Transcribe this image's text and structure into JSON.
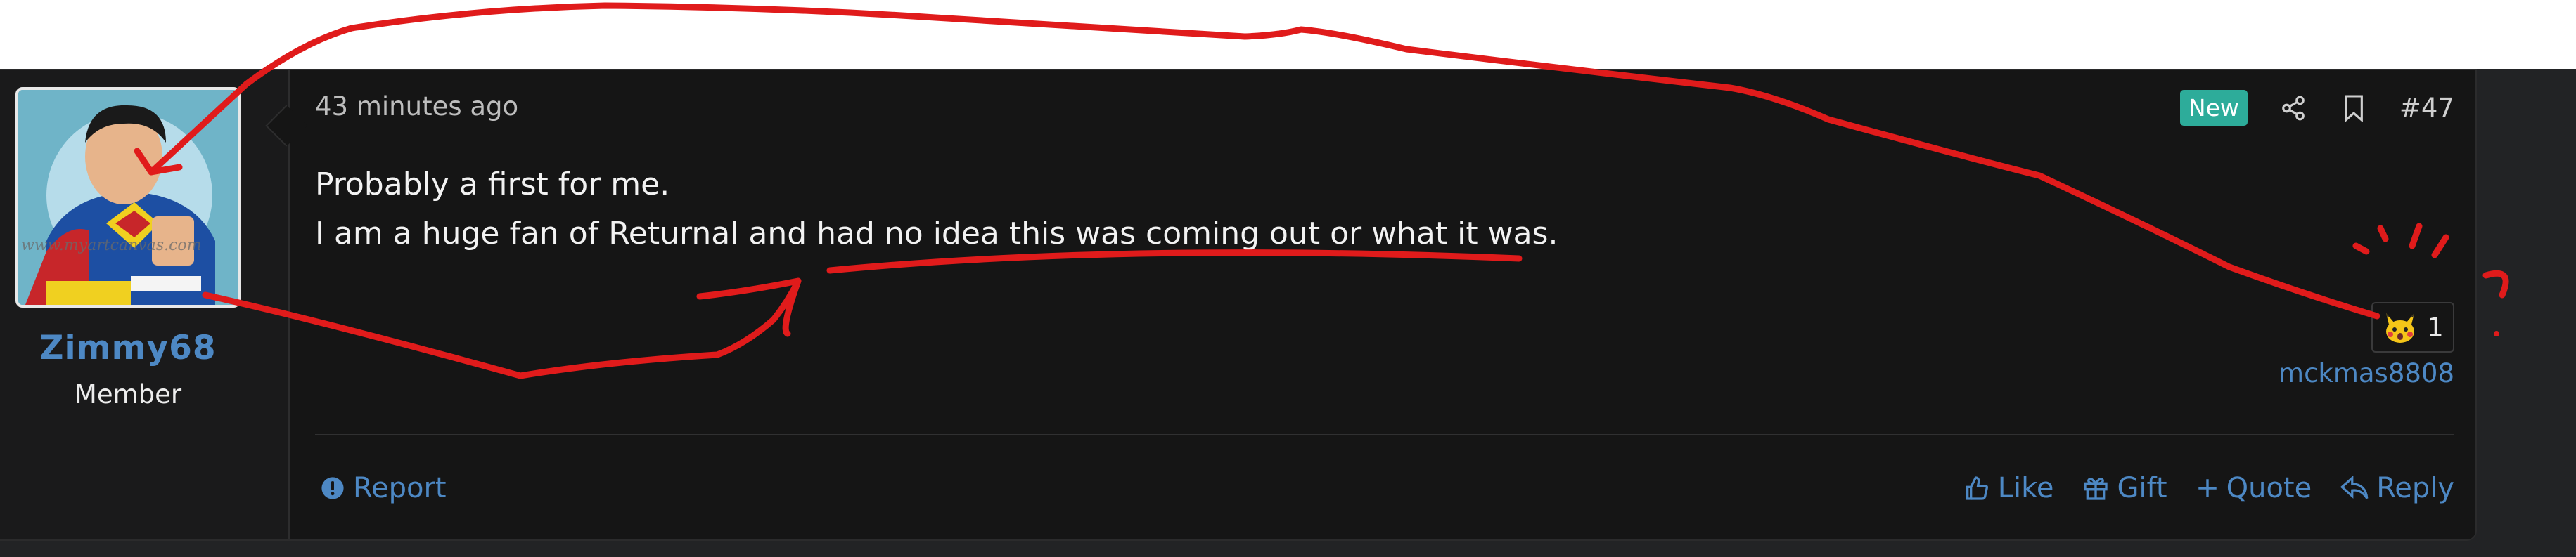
{
  "post": {
    "timestamp": "43 minutes ago",
    "new_badge": "New",
    "post_number": "#47",
    "body_lines": [
      "Probably a first for me.",
      "I am a huge fan of Returnal and had no idea this was coming out or what it was."
    ],
    "reaction": {
      "count": "1",
      "reactor": "mckmas8808",
      "icon": "pikachu-emoji-icon"
    }
  },
  "author": {
    "username": "Zimmy68",
    "title": "Member",
    "avatar_watermark": "www.myartcanvas.com"
  },
  "footer": {
    "report_label": "Report",
    "like_label": "Like",
    "gift_label": "Gift",
    "quote_label": "Quote",
    "reply_label": "Reply"
  },
  "annotation": {
    "question_mark": "?"
  },
  "colors": {
    "link": "#4d88c4",
    "new_badge": "#2dac9a",
    "annotation": "#e01b1b"
  }
}
